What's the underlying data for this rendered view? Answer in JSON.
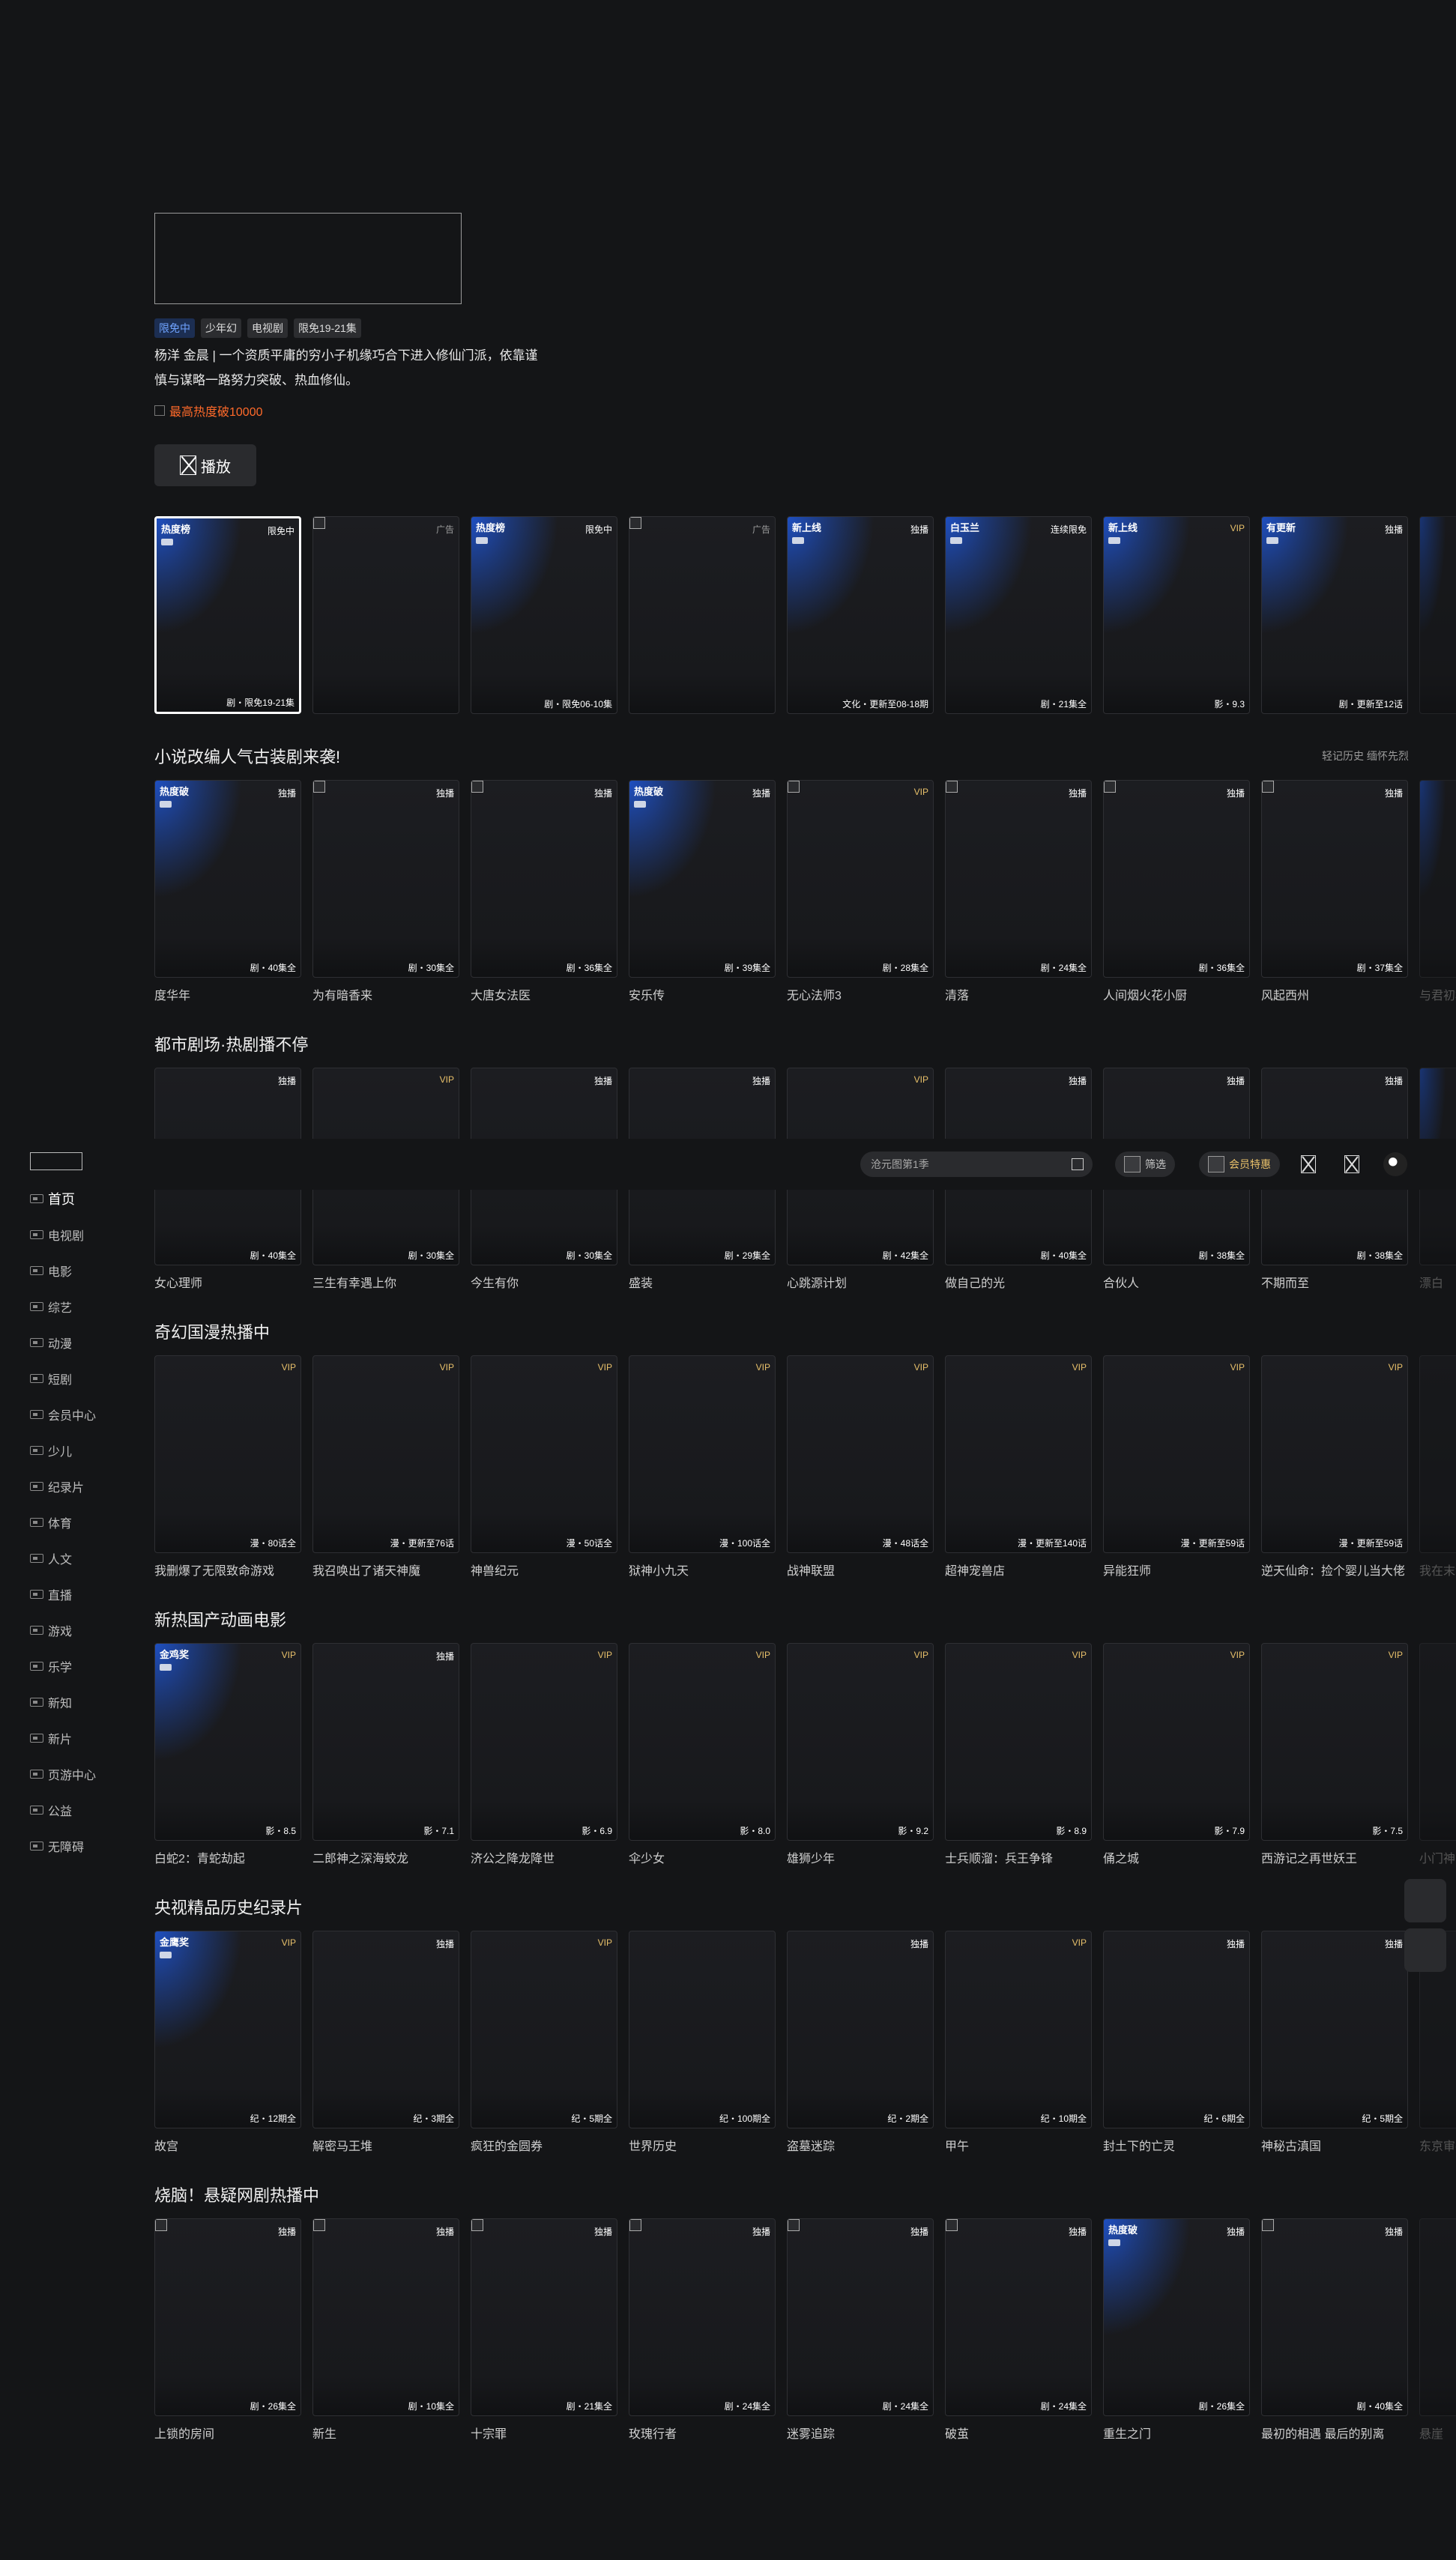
{
  "sidebar": {
    "items": [
      "首页",
      "电视剧",
      "电影",
      "综艺",
      "动漫",
      "短剧",
      "会员中心",
      "少儿",
      "纪录片",
      "体育",
      "人文",
      "直播",
      "游戏",
      "乐学",
      "新知",
      "新片",
      "页游中心",
      "公益",
      "无障碍"
    ]
  },
  "header": {
    "search_placeholder": "沧元图第1季",
    "filter_label": "筛选",
    "vip_label": "会员特惠"
  },
  "hero": {
    "tags": [
      "限免中",
      "少年幻",
      "电视剧",
      "限免19-21集"
    ],
    "description": "杨洋 金晨 | 一个资质平庸的穷小子机缘巧合下进入修仙门派，依靠谨慎与谋略一路努力突破、热血修仙。",
    "hot_text": "最高热度破10000",
    "play_label": "播放"
  },
  "hero_row": [
    {
      "tl": "热度榜",
      "tr": "限免中",
      "foot": "剧・限免19-21集"
    },
    {
      "tl": "",
      "tr": "广告",
      "foot": ""
    },
    {
      "tl": "热度榜",
      "tr": "限免中",
      "foot": "剧・限免06-10集"
    },
    {
      "tl": "",
      "tr": "广告",
      "foot": ""
    },
    {
      "tl": "新上线",
      "tr": "独播",
      "foot": "文化・更新至08-18期"
    },
    {
      "tl": "白玉兰",
      "tr": "连续限免",
      "foot": "剧・21集全"
    },
    {
      "tl": "新上线",
      "tr": "VIP",
      "foot": "影・9.3"
    },
    {
      "tl": "有更新",
      "tr": "独播",
      "foot": "剧・更新至12话"
    }
  ],
  "sections": [
    {
      "title": "小说改编人气古装剧来袭!",
      "extra": "轻记历史 缅怀先烈",
      "items": [
        {
          "tl": "热度破",
          "tr": "独播",
          "foot": "剧・40集全",
          "title": "度华年"
        },
        {
          "tl": "",
          "tr": "独播",
          "foot": "剧・30集全",
          "title": "为有暗香来"
        },
        {
          "tl": "",
          "tr": "独播",
          "foot": "剧・36集全",
          "title": "大唐女法医"
        },
        {
          "tl": "热度破",
          "tr": "独播",
          "foot": "剧・39集全",
          "title": "安乐传"
        },
        {
          "tl": "",
          "tr": "VIP",
          "foot": "剧・28集全",
          "title": "无心法师3"
        },
        {
          "tl": "",
          "tr": "独播",
          "foot": "剧・24集全",
          "title": "清落"
        },
        {
          "tl": "",
          "tr": "独播",
          "foot": "剧・36集全",
          "title": "人间烟火花小厨"
        },
        {
          "tl": "",
          "tr": "独播",
          "foot": "剧・37集全",
          "title": "风起西州"
        }
      ],
      "ghost": "与君初相识"
    },
    {
      "title": "都市剧场·热剧播不停",
      "items": [
        {
          "tr": "独播",
          "foot": "剧・40集全",
          "title": "女心理师"
        },
        {
          "tr": "VIP",
          "foot": "剧・30集全",
          "title": "三生有幸遇上你"
        },
        {
          "tr": "独播",
          "foot": "剧・30集全",
          "title": "今生有你"
        },
        {
          "tr": "独播",
          "foot": "剧・29集全",
          "title": "盛装"
        },
        {
          "tr": "VIP",
          "foot": "剧・42集全",
          "title": "心跳源计划"
        },
        {
          "tr": "独播",
          "foot": "剧・40集全",
          "title": "做自己的光"
        },
        {
          "tr": "独播",
          "foot": "剧・38集全",
          "title": "合伙人"
        },
        {
          "tr": "独播",
          "foot": "剧・38集全",
          "title": "不期而至"
        }
      ],
      "ghost": "漂白"
    },
    {
      "title": "奇幻国漫热播中",
      "items": [
        {
          "tr": "VIP",
          "foot": "漫・80话全",
          "title": "我删爆了无限致命游戏"
        },
        {
          "tr": "VIP",
          "foot": "漫・更新至76话",
          "title": "我召唤出了诸天神魔"
        },
        {
          "tr": "VIP",
          "foot": "漫・50话全",
          "title": "神兽纪元"
        },
        {
          "tr": "VIP",
          "foot": "漫・100话全",
          "title": "狱神小九天"
        },
        {
          "tr": "VIP",
          "foot": "漫・48话全",
          "title": "战神联盟"
        },
        {
          "tr": "VIP",
          "foot": "漫・更新至140话",
          "title": "超神宠兽店"
        },
        {
          "tr": "VIP",
          "foot": "漫・更新至59话",
          "title": "异能狂师"
        },
        {
          "tr": "VIP",
          "foot": "漫・更新至59话",
          "title": "逆天仙命：捡个婴儿当大佬"
        }
      ],
      "ghost": "我在末世"
    },
    {
      "title": "新热国产动画电影",
      "items": [
        {
          "tl": "金鸡奖",
          "tr": "VIP",
          "foot": "影・8.5",
          "title": "白蛇2：青蛇劫起"
        },
        {
          "tr": "独播",
          "foot": "影・7.1",
          "title": "二郎神之深海蛟龙"
        },
        {
          "tr": "VIP",
          "foot": "影・6.9",
          "title": "济公之降龙降世"
        },
        {
          "tr": "VIP",
          "foot": "影・8.0",
          "title": "伞少女"
        },
        {
          "tr": "VIP",
          "foot": "影・9.2",
          "title": "雄狮少年"
        },
        {
          "tr": "VIP",
          "foot": "影・8.9",
          "title": "士兵顺溜：兵王争锋"
        },
        {
          "tr": "VIP",
          "foot": "影・7.9",
          "title": "俑之城"
        },
        {
          "tr": "VIP",
          "foot": "影・7.5",
          "title": "西游记之再世妖王"
        }
      ],
      "ghost": "小门神"
    },
    {
      "title": "央视精品历史纪录片",
      "items": [
        {
          "tl": "金鹰奖",
          "tr": "VIP",
          "foot": "纪・12期全",
          "title": "故宫"
        },
        {
          "tr": "独播",
          "foot": "纪・3期全",
          "title": "解密马王堆"
        },
        {
          "tr": "VIP",
          "foot": "纪・5期全",
          "title": "疯狂的金圆券"
        },
        {
          "tr": "",
          "foot": "纪・100期全",
          "title": "世界历史"
        },
        {
          "tr": "独播",
          "foot": "纪・2期全",
          "title": "盗墓迷踪"
        },
        {
          "tr": "VIP",
          "foot": "纪・10期全",
          "title": "甲午"
        },
        {
          "tr": "独播",
          "foot": "纪・6期全",
          "title": "封土下的亡灵"
        },
        {
          "tr": "独播",
          "foot": "纪・5期全",
          "title": "神秘古滇国"
        }
      ],
      "ghost": "东京审判"
    },
    {
      "title": "烧脑！悬疑网剧热播中",
      "items": [
        {
          "tr": "独播",
          "foot": "剧・26集全",
          "title": "上锁的房间"
        },
        {
          "tr": "独播",
          "foot": "剧・10集全",
          "title": "新生"
        },
        {
          "tr": "独播",
          "foot": "剧・21集全",
          "title": "十宗罪"
        },
        {
          "tr": "独播",
          "foot": "剧・24集全",
          "title": "玫瑰行者"
        },
        {
          "tr": "独播",
          "foot": "剧・24集全",
          "title": "迷雾追踪"
        },
        {
          "tr": "独播",
          "foot": "剧・24集全",
          "title": "破茧"
        },
        {
          "tl": "热度破",
          "tr": "独播",
          "foot": "剧・26集全",
          "title": "重生之门"
        },
        {
          "tr": "独播",
          "foot": "剧・40集全",
          "title": "最初的相遇 最后的别离"
        }
      ],
      "ghost": "悬崖"
    }
  ]
}
